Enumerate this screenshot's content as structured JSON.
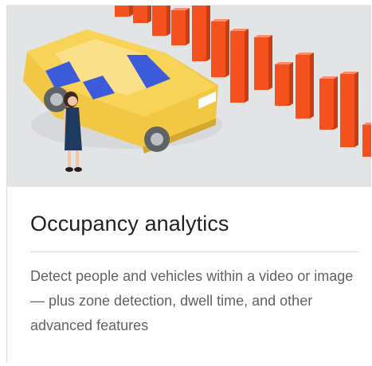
{
  "card": {
    "title": "Occupancy analytics",
    "description": "Detect people and vehicles within a video or image — plus zone detection, dwell time, and other advanced features"
  },
  "illustration": {
    "background_color": "#e3e4e6",
    "car_color": "#f7d358",
    "bar_color": "#f4511e",
    "window_color": "#3b5bdb",
    "icons": [
      "car-icon",
      "person-icon",
      "bar-chart-icon"
    ]
  }
}
